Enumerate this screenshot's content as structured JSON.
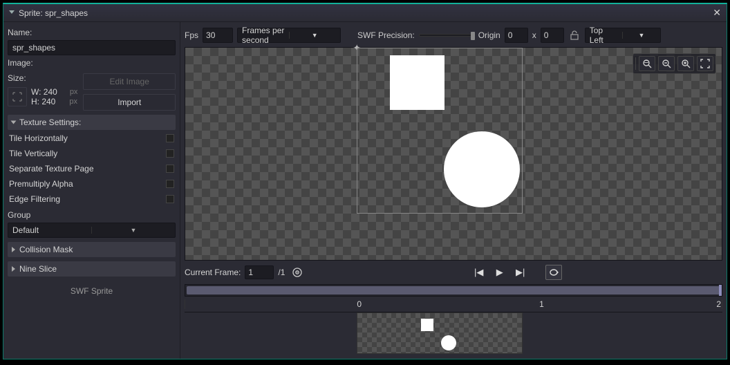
{
  "title": "Sprite: spr_shapes",
  "name_label": "Name:",
  "name_value": "spr_shapes",
  "image_label": "Image:",
  "size_label": "Size:",
  "size_w": "W: 240",
  "size_h": "H: 240",
  "px": "px",
  "edit_image": "Edit Image",
  "import": "Import",
  "texture_settings": "Texture Settings:",
  "tex_checks": [
    "Tile Horizontally",
    "Tile Vertically",
    "Separate Texture Page",
    "Premultiply Alpha",
    "Edge Filtering"
  ],
  "group_label": "Group",
  "group_value": "Default",
  "collision_mask": "Collision Mask",
  "nine_slice": "Nine Slice",
  "swf_sprite": "SWF Sprite",
  "fps_label": "Fps",
  "fps_value": "30",
  "fps_mode": "Frames per second",
  "swf_precision": "SWF Precision:",
  "origin_label": "Origin",
  "origin_x": "0",
  "origin_sep": "x",
  "origin_y": "0",
  "origin_anchor": "Top Left",
  "current_frame_label": "Current Frame:",
  "current_frame_value": "1",
  "current_frame_total": "/1",
  "ruler": {
    "t0": "0",
    "t1": "1",
    "t2": "2"
  }
}
